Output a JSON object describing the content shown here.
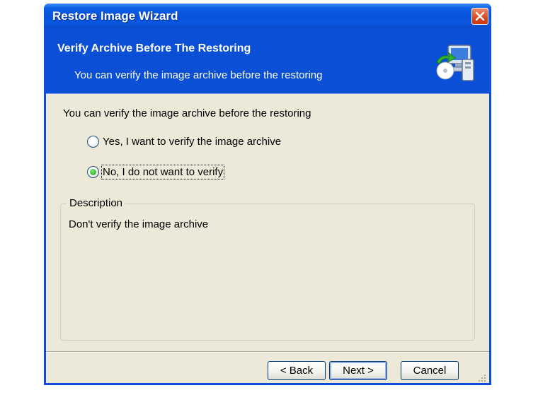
{
  "window": {
    "title": "Restore Image Wizard"
  },
  "header": {
    "title": "Verify Archive Before The Restoring",
    "subtitle": "You can verify the image archive before the restoring"
  },
  "content": {
    "intro": "You can verify the image archive before the restoring",
    "options": [
      {
        "label": "Yes, I want to verify the image archive",
        "checked": false
      },
      {
        "label": "No, I  do not want to verify",
        "checked": true
      }
    ]
  },
  "description": {
    "legend": "Description",
    "text": "Don't verify the image archive"
  },
  "buttons": {
    "back": "< Back",
    "next": "Next >",
    "cancel": "Cancel"
  },
  "colors": {
    "title_bar": "#0a4fd6",
    "dialog_background": "#ece9d8",
    "close_button": "#d9491e",
    "radio_checked": "#21a121"
  },
  "icons": {
    "close": "close-icon",
    "header": "computer-restore-icon",
    "grip": "resize-grip-icon"
  }
}
